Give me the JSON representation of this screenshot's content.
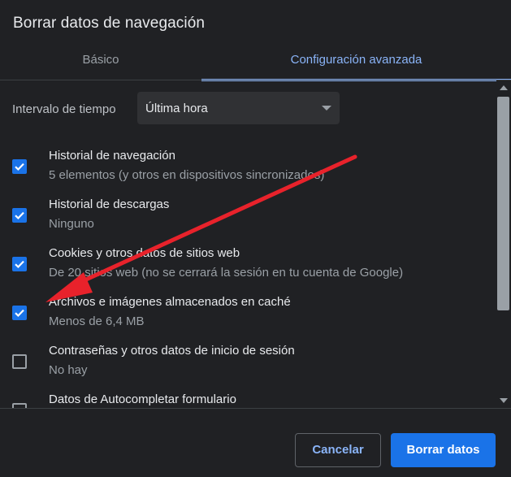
{
  "dialog": {
    "title": "Borrar datos de navegación"
  },
  "tabs": [
    {
      "label": "Básico"
    },
    {
      "label": "Configuración avanzada"
    }
  ],
  "time_range": {
    "label": "Intervalo de tiempo",
    "value": "Última hora"
  },
  "items": [
    {
      "title": "Historial de navegación",
      "desc": "5 elementos (y otros en dispositivos sincronizados)",
      "checked": true
    },
    {
      "title": "Historial de descargas",
      "desc": "Ninguno",
      "checked": true
    },
    {
      "title": "Cookies y otros datos de sitios web",
      "desc": "De 20 sitios web (no se cerrará la sesión en tu cuenta de Google)",
      "checked": true
    },
    {
      "title": "Archivos e imágenes almacenados en caché",
      "desc": "Menos de 6,4 MB",
      "checked": true
    },
    {
      "title": "Contraseñas y otros datos de inicio de sesión",
      "desc": "No hay",
      "checked": false
    },
    {
      "title": "Datos de Autocompletar formulario",
      "desc": "",
      "checked": false
    }
  ],
  "buttons": {
    "cancel": "Cancelar",
    "clear": "Borrar datos"
  },
  "colors": {
    "background": "#202124",
    "accent": "#8ab4f8",
    "primary": "#1a73e8",
    "arrow": "#e8222b"
  }
}
